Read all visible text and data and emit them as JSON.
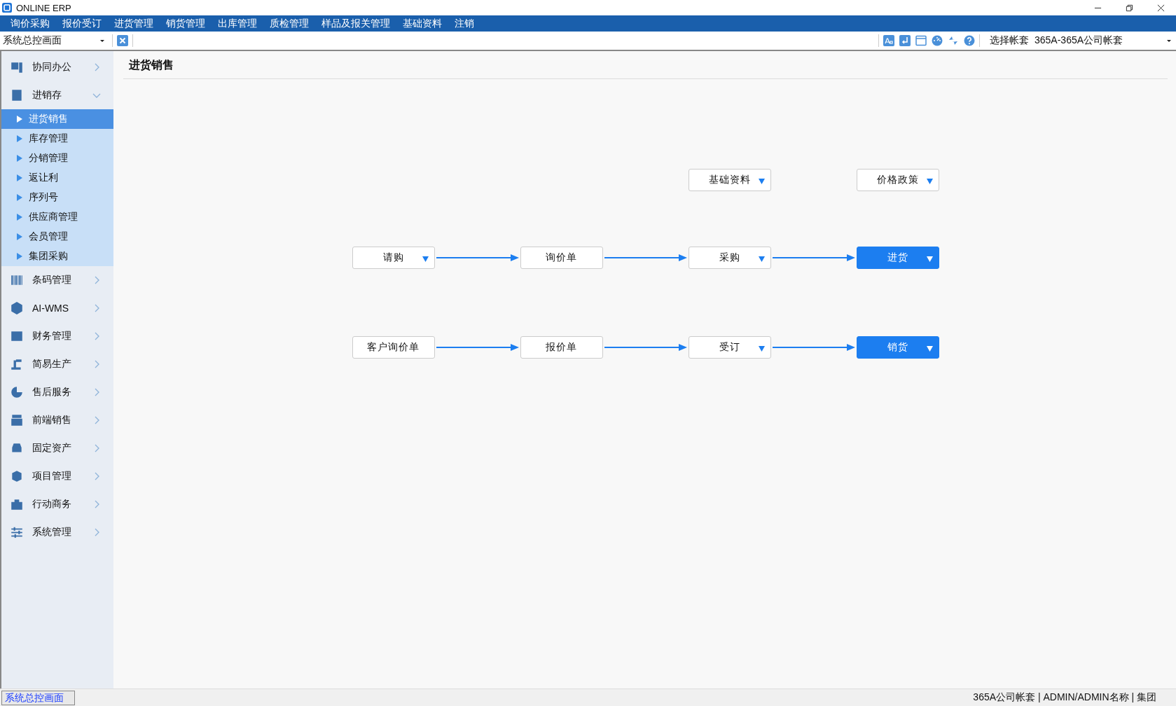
{
  "window": {
    "title": "ONLINE ERP"
  },
  "menu": [
    "询价采购",
    "报价受订",
    "进货管理",
    "销货管理",
    "出库管理",
    "质检管理",
    "样品及报关管理",
    "基础资料",
    "注销"
  ],
  "toolbar": {
    "page_select": "系统总控画面",
    "account_label": "选择帐套",
    "account_select": "365A-365A公司帐套"
  },
  "sidebar": {
    "items": [
      {
        "label": "协同办公",
        "expanded": false
      },
      {
        "label": "进销存",
        "expanded": true,
        "children": [
          {
            "label": "进货销售",
            "selected": true
          },
          {
            "label": "库存管理",
            "selected": false
          },
          {
            "label": "分销管理",
            "selected": false
          },
          {
            "label": "返让利",
            "selected": false
          },
          {
            "label": "序列号",
            "selected": false
          },
          {
            "label": "供应商管理",
            "selected": false
          },
          {
            "label": "会员管理",
            "selected": false
          },
          {
            "label": "集团采购",
            "selected": false
          }
        ]
      },
      {
        "label": "条码管理",
        "expanded": false
      },
      {
        "label": "AI-WMS",
        "expanded": false
      },
      {
        "label": "财务管理",
        "expanded": false
      },
      {
        "label": "简易生产",
        "expanded": false
      },
      {
        "label": "售后服务",
        "expanded": false
      },
      {
        "label": "前端销售",
        "expanded": false
      },
      {
        "label": "固定资产",
        "expanded": false
      },
      {
        "label": "项目管理",
        "expanded": false
      },
      {
        "label": "行动商务",
        "expanded": false
      },
      {
        "label": "系统管理",
        "expanded": false
      }
    ]
  },
  "content": {
    "title": "进货销售",
    "reference_nodes": [
      {
        "label": "基础资料",
        "dropdown": true,
        "highlighted": false
      },
      {
        "label": "价格政策",
        "dropdown": true,
        "highlighted": false
      }
    ],
    "chains": [
      {
        "nodes": [
          {
            "label": "请购",
            "dropdown": true,
            "highlighted": false
          },
          {
            "label": "询价单",
            "dropdown": false,
            "highlighted": false
          },
          {
            "label": "采购",
            "dropdown": true,
            "highlighted": false
          },
          {
            "label": "进货",
            "dropdown": true,
            "highlighted": true
          }
        ]
      },
      {
        "nodes": [
          {
            "label": "客户询价单",
            "dropdown": false,
            "highlighted": false
          },
          {
            "label": "报价单",
            "dropdown": false,
            "highlighted": false
          },
          {
            "label": "受订",
            "dropdown": true,
            "highlighted": false
          },
          {
            "label": "销货",
            "dropdown": true,
            "highlighted": true
          }
        ]
      }
    ]
  },
  "status_bar": {
    "page": "系统总控画面",
    "info": "365A公司帐套 | ADMIN/ADMIN名称 | 集团"
  }
}
